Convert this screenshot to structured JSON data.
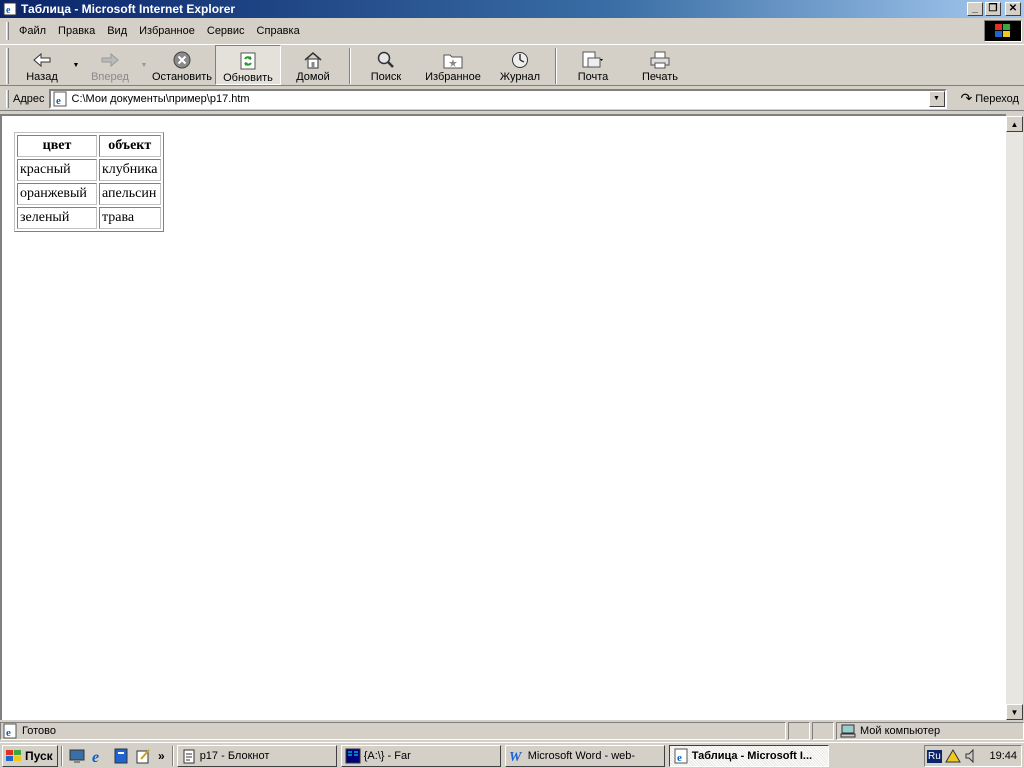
{
  "window": {
    "title": "Таблица - Microsoft Internet Explorer"
  },
  "menu": [
    "Файл",
    "Правка",
    "Вид",
    "Избранное",
    "Сервис",
    "Справка"
  ],
  "toolbar": {
    "back": "Назад",
    "forward": "Вперед",
    "stop": "Остановить",
    "refresh": "Обновить",
    "home": "Домой",
    "search": "Поиск",
    "favorites": "Избранное",
    "history": "Журнал",
    "mail": "Почта",
    "print": "Печать"
  },
  "address": {
    "label": "Адрес",
    "value": "C:\\Мои документы\\пример\\p17.htm",
    "go": "Переход"
  },
  "page": {
    "headers": [
      "цвет",
      "объект"
    ],
    "rows": [
      [
        "красный",
        "клубника"
      ],
      [
        "оранжевый",
        "апельсин"
      ],
      [
        "зеленый",
        "трава"
      ]
    ]
  },
  "status": {
    "text": "Готово",
    "zone": "Мой компьютер"
  },
  "taskbar": {
    "start": "Пуск",
    "tasks": [
      "p17 - Блокнот",
      "{A:\\} - Far",
      "Microsoft Word - web-",
      "Таблица - Microsoft I..."
    ],
    "lang": "Ru",
    "clock": "19:44"
  }
}
